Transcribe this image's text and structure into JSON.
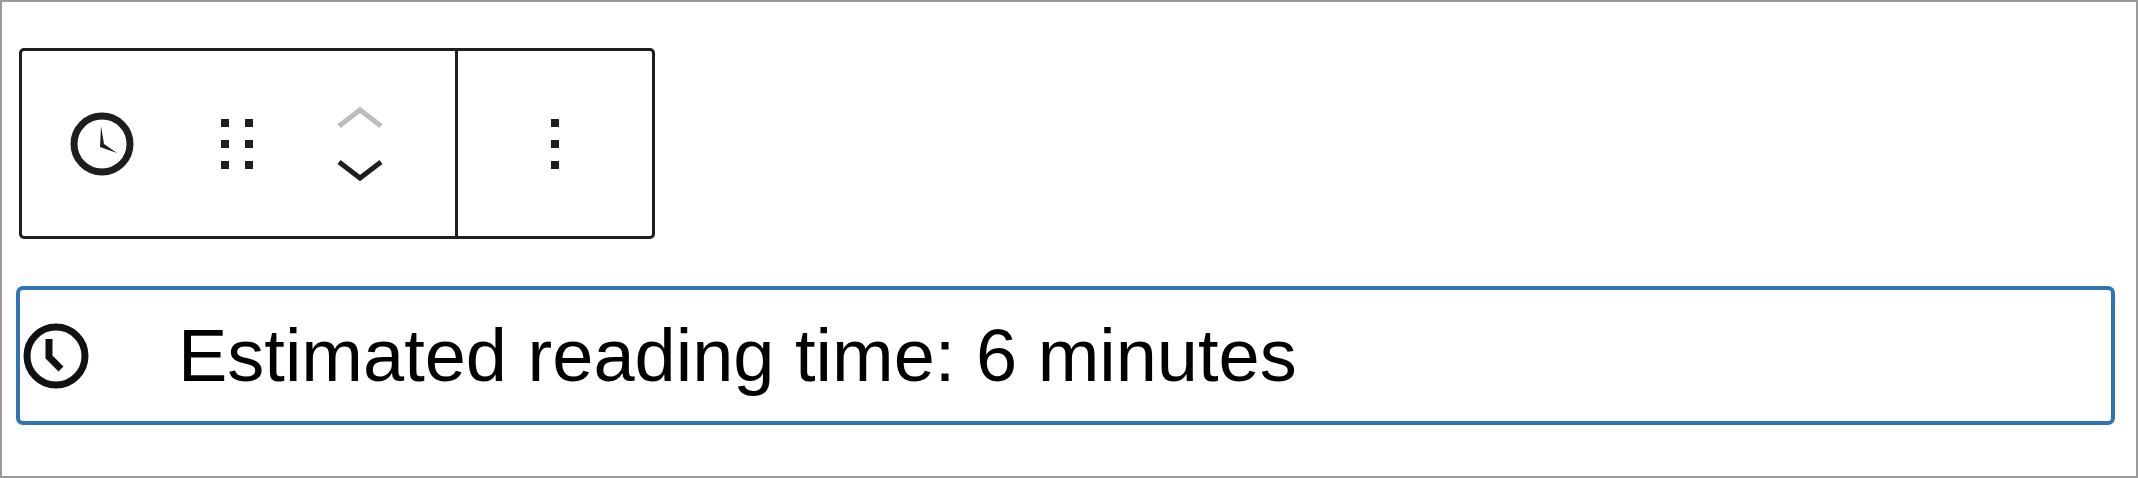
{
  "toolbar": {
    "buttons": [
      {
        "kind": "block-icon",
        "disabled": false
      },
      {
        "kind": "drag-handle",
        "disabled": false
      },
      {
        "kind": "move-up",
        "disabled": true
      },
      {
        "kind": "move-down",
        "disabled": false
      },
      {
        "kind": "options",
        "disabled": false
      }
    ]
  },
  "block": {
    "selected": true,
    "text": "Estimated reading time: 6 minutes"
  }
}
